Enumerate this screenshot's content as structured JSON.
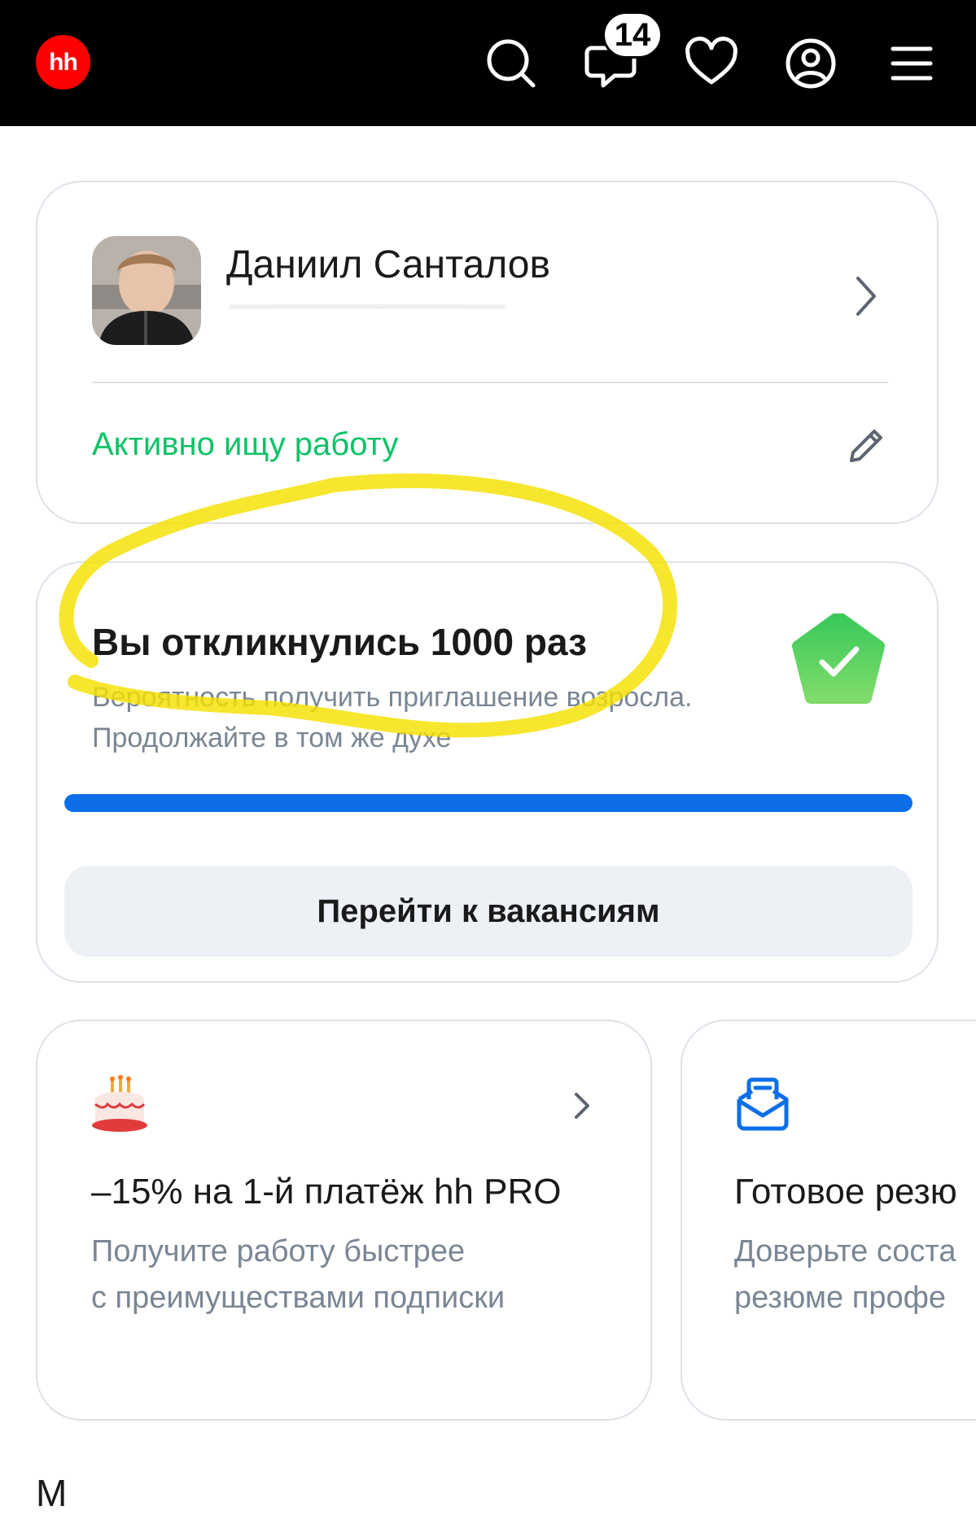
{
  "header": {
    "logo_text": "hh",
    "logo_color": "#ff0000",
    "icons": [
      "search-icon",
      "chat-icon",
      "heart-icon",
      "profile-icon",
      "menu-icon"
    ],
    "chat_badge_count": "14"
  },
  "profile": {
    "name": "Даниил Санталов",
    "status": "Активно ищу работу",
    "status_color": "#0dc267"
  },
  "responses": {
    "title": "Вы откликнулись 1000 раз",
    "description": "Вероятность получить приглашение возросла. Продолжайте в том же духе",
    "progress": 1.0,
    "progress_color": "#0d6ee8",
    "button_label": "Перейти к вакансиям"
  },
  "promos": [
    {
      "icon": "cake-icon",
      "title": "–15% на 1-й платёж hh PRO",
      "desc_line1": "Получите работу быстрее",
      "desc_line2": "с преимуществами подписки"
    },
    {
      "icon": "envelope-icon",
      "title": "Готовое резю",
      "desc_line1": "Доверьте соста",
      "desc_line2": "резюме профе"
    }
  ],
  "section_heading_partial": "М",
  "annotation_color": "#f5e100"
}
